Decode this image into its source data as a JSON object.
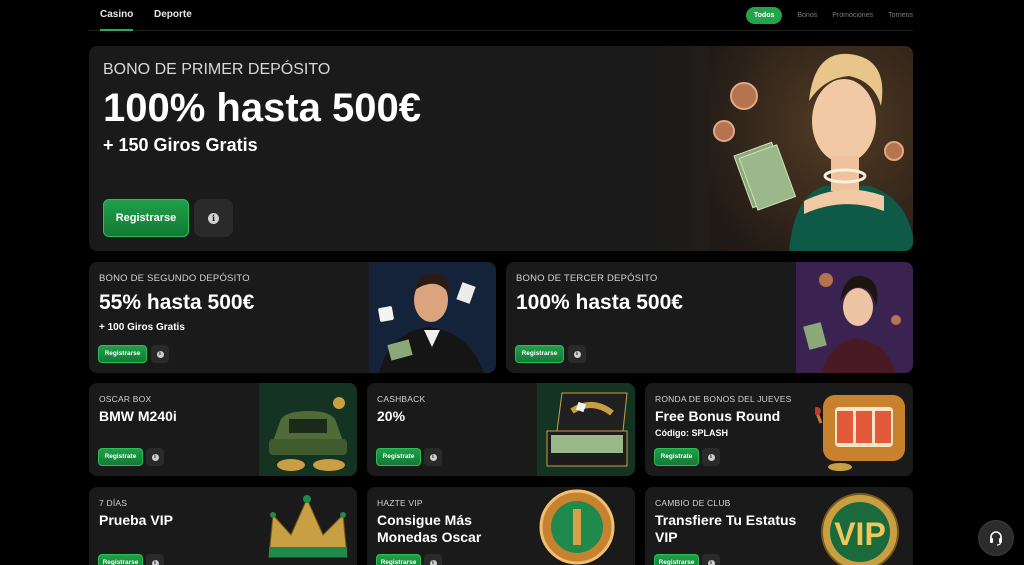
{
  "nav": {
    "tabs": [
      {
        "label": "Casino",
        "active": true
      },
      {
        "label": "Deporte",
        "active": false
      }
    ],
    "filters": [
      {
        "label": "Todos",
        "active": true
      },
      {
        "label": "Bonos",
        "active": false
      },
      {
        "label": "Promociones",
        "active": false
      },
      {
        "label": "Torneos",
        "active": false
      }
    ]
  },
  "hero": {
    "label": "BONO DE PRIMER DEPÓSITO",
    "title": "100% hasta 500€",
    "subtitle": "+ 150 Giros Gratis",
    "button": "Registrarse",
    "info_icon": "info-icon"
  },
  "promos_row2": [
    {
      "label": "BONO DE SEGUNDO DEPÓSITO",
      "title": "55% hasta 500€",
      "subtitle": "+ 100 Giros Gratis",
      "button": "Registrarse"
    },
    {
      "label": "BONO DE TERCER DEPÓSITO",
      "title": "100% hasta 500€",
      "subtitle": "",
      "button": "Registrarse"
    }
  ],
  "promos_row3": [
    {
      "label": "OSCAR BOX",
      "title": "BMW M240i",
      "subtitle": "",
      "button": "Registrate"
    },
    {
      "label": "CASHBACK",
      "title": "20%",
      "subtitle": "",
      "button": "Registrate"
    },
    {
      "label": "RONDA DE BONOS DEL JUEVES",
      "title": "Free Bonus Round",
      "subtitle": "Código: SPLASH",
      "button": "Registrate"
    }
  ],
  "promos_row4": [
    {
      "label": "7 DÍAS",
      "title": "Prueba VIP",
      "button": "Registrarse"
    },
    {
      "label": "HAZTE VIP",
      "title": "Consigue Más Monedas Oscar",
      "button": "Registrarse"
    },
    {
      "label": "CAMBIO DE CLUB",
      "title": "Transfiere Tu Estatus VIP",
      "button": "Registrarse"
    }
  ],
  "art": {
    "vip_badge": "VIP"
  },
  "colors": {
    "accent": "#23a449",
    "card_bg": "#1a1a1a",
    "page_bg": "#000000"
  }
}
